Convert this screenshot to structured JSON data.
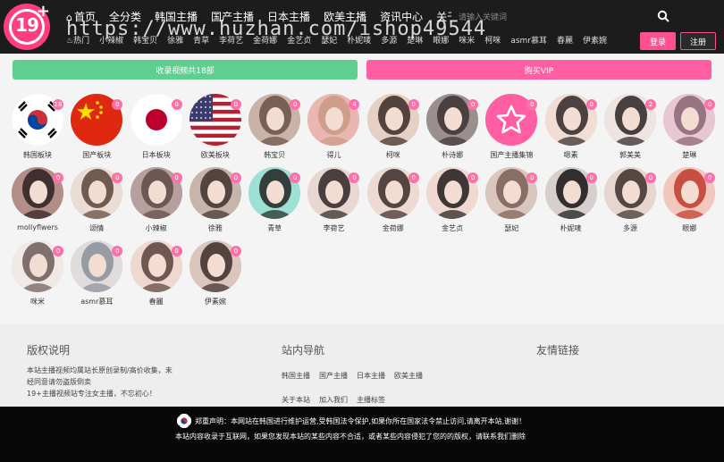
{
  "logo": {
    "text": "19",
    "plus": "+"
  },
  "watermark": "https://www.huzhan.com/ishop49544",
  "nav": [
    {
      "label": "首页",
      "icon": "home-icon"
    },
    {
      "label": "全分类"
    },
    {
      "label": "韩国主播"
    },
    {
      "label": "国产主播"
    },
    {
      "label": "日本主播"
    },
    {
      "label": "欧美主播"
    },
    {
      "label": "资讯中心"
    },
    {
      "label": "关于本站"
    }
  ],
  "subnav": [
    "热门",
    "小辣椒",
    "韩宝贝",
    "徐雅",
    "青草",
    "李荷艺",
    "金荷娜",
    "金艺贞",
    "瑟妃",
    "朴妮唛",
    "多源",
    "楚琳",
    "眼娜",
    "咪米",
    "柯咪",
    "asmr慕耳",
    "春麗",
    "伊素婉"
  ],
  "search": {
    "placeholder": "请输入关键词"
  },
  "auth": {
    "login": "登录",
    "register": "注册"
  },
  "banners": {
    "green": "收录视频共18部",
    "pink": "购买VIP"
  },
  "accent": "#ff4f93",
  "green": "#5fcf8f",
  "items": [
    {
      "name": "韩国板块",
      "badge": "18",
      "type": "kr"
    },
    {
      "name": "国产板块",
      "badge": "0",
      "type": "cn"
    },
    {
      "name": "日本板块",
      "badge": "0",
      "type": "jp"
    },
    {
      "name": "欧美板块",
      "badge": "0",
      "type": "us"
    },
    {
      "name": "韩宝贝",
      "badge": "0",
      "type": "p",
      "c": [
        "#c9b3a8",
        "#6b5149"
      ]
    },
    {
      "name": "得儿",
      "badge": "4",
      "type": "p",
      "c": [
        "#e9b6b2",
        "#c99a83"
      ]
    },
    {
      "name": "柯咪",
      "badge": "0",
      "type": "p",
      "c": [
        "#e6cfc3",
        "#3a2a25"
      ]
    },
    {
      "name": "朴诗娜",
      "badge": "0",
      "type": "p",
      "c": [
        "#9b8f8e",
        "#3d3333"
      ]
    },
    {
      "name": "国产主播集锦",
      "badge": "0",
      "type": "star"
    },
    {
      "name": "嗯素",
      "badge": "0",
      "type": "p",
      "c": [
        "#f1ddd4",
        "#2f2626"
      ]
    },
    {
      "name": "郭美美",
      "badge": "2",
      "type": "p",
      "c": [
        "#eee5e2",
        "#2a2222"
      ]
    },
    {
      "name": "楚琳",
      "badge": "0",
      "type": "p",
      "c": [
        "#e7c7d1",
        "#8a6472"
      ]
    },
    {
      "name": "mollyflwers",
      "badge": "0",
      "type": "p",
      "c": [
        "#b28e87",
        "#2b2020"
      ]
    },
    {
      "name": "颂情",
      "badge": "0",
      "type": "p",
      "c": [
        "#e9ddd5",
        "#5c4338"
      ]
    },
    {
      "name": "小辣椒",
      "badge": "0",
      "type": "p",
      "c": [
        "#b79f9d",
        "#5e4b4a"
      ]
    },
    {
      "name": "徐雅",
      "badge": "0",
      "type": "p",
      "c": [
        "#c7b4ab",
        "#3e302c"
      ]
    },
    {
      "name": "青草",
      "badge": "0",
      "type": "p",
      "c": [
        "#9de0d6",
        "#222"
      ]
    },
    {
      "name": "李荷艺",
      "badge": "0",
      "type": "p",
      "c": [
        "#e8d8d1",
        "#2b2424"
      ]
    },
    {
      "name": "金荷娜",
      "badge": "0",
      "type": "p",
      "c": [
        "#eddad3",
        "#3a2a27"
      ]
    },
    {
      "name": "金艺贞",
      "badge": "0",
      "type": "p",
      "c": [
        "#f0d9d0",
        "#1f1a1a"
      ]
    },
    {
      "name": "瑟妃",
      "badge": "0",
      "type": "p",
      "c": [
        "#d9c7bf",
        "#7a5e52"
      ]
    },
    {
      "name": "朴妮唛",
      "badge": "0",
      "type": "p",
      "c": [
        "#d6cfcd",
        "#151212"
      ]
    },
    {
      "name": "多源",
      "badge": "0",
      "type": "p",
      "c": [
        "#e6d6cf",
        "#3a2e2c"
      ]
    },
    {
      "name": "眼娜",
      "badge": "0",
      "type": "p",
      "c": [
        "#f2c7bd",
        "#c0392b"
      ]
    },
    {
      "name": "咪米",
      "badge": "0",
      "type": "p",
      "c": [
        "#f1e9e6",
        "#6b5a57"
      ]
    },
    {
      "name": "asmr慕耳",
      "badge": "0",
      "type": "p",
      "c": [
        "#e0dcdb",
        "#8a8f9a"
      ]
    },
    {
      "name": "春麗",
      "badge": "0",
      "type": "p",
      "c": [
        "#eed9d1",
        "#5a403a"
      ]
    },
    {
      "name": "伊素婉",
      "badge": "0",
      "type": "p",
      "c": [
        "#dcc5bd",
        "#3c2a27"
      ]
    }
  ],
  "footer": {
    "copyright_title": "版权说明",
    "copyright_lines": [
      "本站主播视频均属站长原创录制/高价收集，未",
      "经同意请勿盗版倒卖",
      "19+主播视频站专注女主播，不忘初心！"
    ],
    "nav_title": "站内导航",
    "nav_links": [
      "韩国主播",
      "国产主播",
      "日本主播",
      "欧美主播",
      "关于本站",
      "加入我们",
      "主播标签"
    ],
    "friends_title": "友情链接",
    "notice1": "郑重声明：本网站在韩国进行维护运营,受韩国法令保护,如果你所在国家法令禁止访问,请离开本站,谢谢！",
    "notice2": "本站内容收录于互联网，如果您发现本站的某些内容不合适，或者某些内容侵犯了您的的版权，请联系我们删除"
  }
}
